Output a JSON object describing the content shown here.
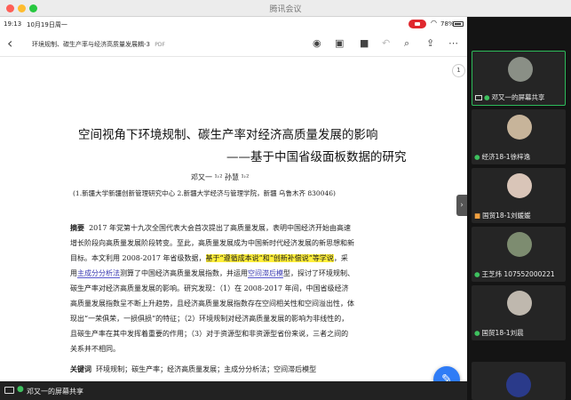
{
  "window": {
    "title": "腾讯会议"
  },
  "status": {
    "time": "19:13",
    "date": "10月19日周一",
    "battery": "78%"
  },
  "doc": {
    "filename": "环境规制、碳生产率与经济高质量发展耦-3",
    "filetype": "PDF"
  },
  "icons": {
    "back": "chevron-left-icon",
    "camera": "camera-icon",
    "sidebar": "sidebar-icon",
    "bookmark": "bookmark-icon",
    "undo": "undo-icon",
    "search": "search-icon",
    "share": "share-icon",
    "more": "more-icon",
    "edit": "pencil-icon"
  },
  "paper": {
    "page_badge": "1",
    "title": "空间视角下环境规制、碳生产率对经济高质量发展的影响",
    "subtitle": "——基于中国省级面板数据的研究",
    "authors": "邓又一 ¹˒² 孙慧 ¹˒²",
    "affiliation": "(1.新疆大学新疆创新管理研究中心 2.新疆大学经济与管理学院，新疆 乌鲁木齐 830046)",
    "abstract_label": "摘要",
    "abstract_l1": "2017 年党第十九次全国代表大会首次提出了高质量发展，表明中国经济开始由高速",
    "abstract_l2": "增长阶段向高质量发展阶段转变。至此，高质量发展成为中国新时代经济发展的新思想和新",
    "abstract_l3_a": "目标。本文利用 2008-2017 年省级数据，",
    "abstract_l3_hl": "基于“遵循成本说”和“创新补偿说”等学说",
    "abstract_l3_b": "，采",
    "abstract_l4_a": "用",
    "abstract_l4_ul1": "主成分分析法",
    "abstract_l4_b": "测算了中国经济高质量发展指数，并运用",
    "abstract_l4_ul2": "空间滞后模",
    "abstract_l4_c": "型，探讨了环境规制、",
    "abstract_l5": "碳生产率对经济高质量发展的影响。研究发现：（1）在 2008-2017 年间，中国省级经济",
    "abstract_l6": "高质量发展指数呈不断上升趋势，且经济高质量发展指数存在空间相关性和空间溢出性，体",
    "abstract_l7": "现出“一荣俱荣，一损俱损”的特征；（2）环境规制对经济高质量发展的影响为非线性的，",
    "abstract_l8": "且碳生产率在其中发挥着重要的作用；（3）对于资源型和非资源型省份来说，三者之间的",
    "abstract_l9": "关系并不相同。",
    "keywords_label": "关键词",
    "keywords": "环境规制；碳生产率；经济高质量发展；主成分分析法；空间滞后模型"
  },
  "sharebar": {
    "text": "邓又一的屏幕共享"
  },
  "participants": [
    {
      "name": "邓又一的屏幕共享",
      "avatar_color": "#8a8f86",
      "active": true,
      "icon": "screen-share-icon"
    },
    {
      "name": "经济18-1徐梓逸",
      "avatar_color": "#c7b49a",
      "active": false,
      "icon": "mic-icon"
    },
    {
      "name": "国贸18-1刘媛媛",
      "avatar_color": "#d9c5b8",
      "active": false,
      "icon": "avatar-badge-icon"
    },
    {
      "name": "王芝炜 107552000221",
      "avatar_color": "#7d8c70",
      "active": false,
      "icon": "mic-icon"
    },
    {
      "name": "国贸18-1刘晨",
      "avatar_color": "#bfb8ae",
      "active": false,
      "icon": "mic-icon"
    }
  ],
  "colors": {
    "highlight": "#ffef3a",
    "accent": "#2dbb5a",
    "fab": "#2f7cf6",
    "record": "#e0282e"
  }
}
